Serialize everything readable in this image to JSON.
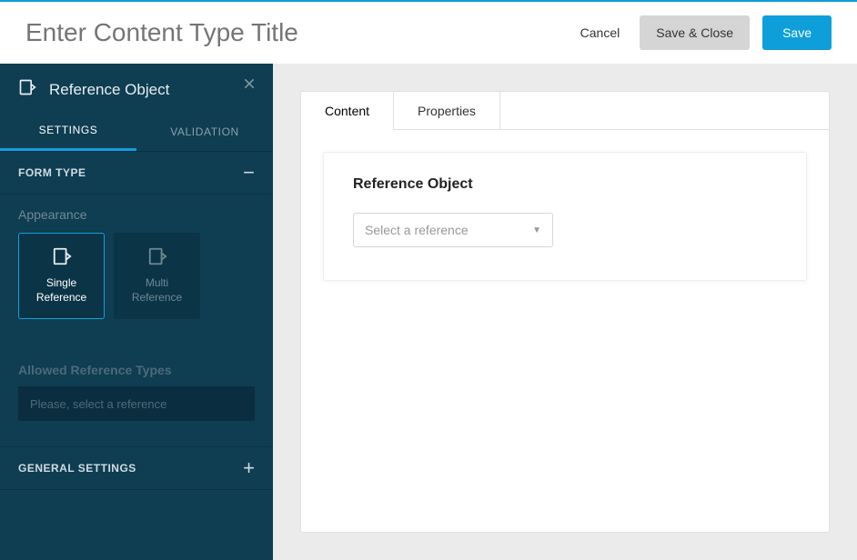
{
  "header": {
    "title_placeholder": "Enter Content Type Title",
    "cancel": "Cancel",
    "save_close": "Save & Close",
    "save": "Save"
  },
  "sidebar": {
    "title": "Reference Object",
    "tabs": {
      "settings": "SETTINGS",
      "validation": "VALIDATION"
    },
    "section_form_type": "FORM TYPE",
    "appearance_label": "Appearance",
    "cards": {
      "single": "Single\nReference",
      "multi": "Multi\nReference"
    },
    "allowed_label": "Allowed Reference Types",
    "allowed_placeholder": "Please, select a reference",
    "section_general": "GENERAL SETTINGS"
  },
  "main": {
    "tabs": {
      "content": "Content",
      "properties": "Properties"
    },
    "card_title": "Reference Object",
    "select_placeholder": "Select a reference"
  }
}
